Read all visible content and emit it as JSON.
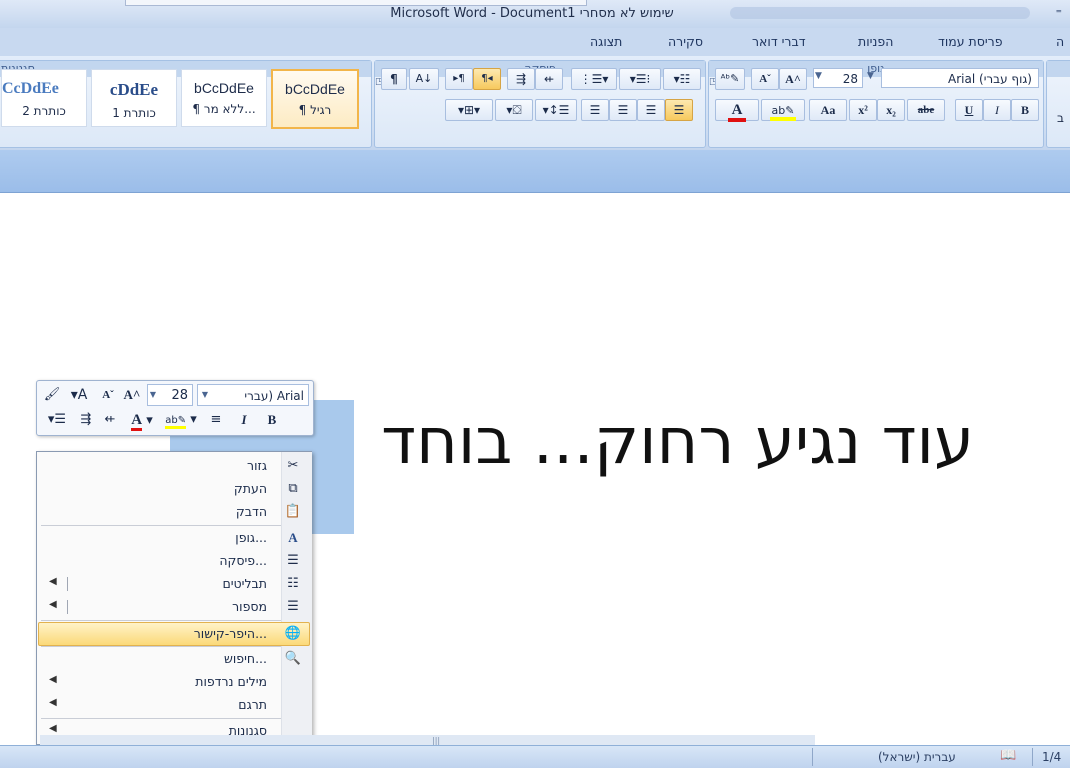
{
  "window": {
    "title_hebrew": "שימוש לא מסחרי",
    "title_app": "Microsoft Word - Document1",
    "quick_access": "⁼"
  },
  "tabs": [
    {
      "label": "ה"
    },
    {
      "label": "פריסת עמוד"
    },
    {
      "label": "הפניות"
    },
    {
      "label": "דברי דואר"
    },
    {
      "label": "סקירה"
    },
    {
      "label": "תצוגה"
    }
  ],
  "ribbon": {
    "font_group": {
      "label": "גופן",
      "font_name": "(גוף עברי) Arial",
      "font_size": "28",
      "bold": "B",
      "italic": "I",
      "underline": "U",
      "strike": "abe",
      "subscript": "x₂",
      "superscript": "x²",
      "change_case": "Aa",
      "grow": "A^",
      "shrink": "Aˇ"
    },
    "paragraph_group": {
      "label": "פיסקה"
    },
    "styles_group": {
      "label": "סגנונות",
      "tiles": [
        {
          "sample": "bCcDdEe",
          "name": "¶ רגיל"
        },
        {
          "sample": "bCcDdEe",
          "name": "¶ ללא מר..."
        },
        {
          "sample": "cDdEe",
          "name": "כותרת 1"
        },
        {
          "sample": "CcDdEe",
          "name": "כותרת 2"
        }
      ]
    },
    "edit_group": {
      "label": "ב"
    }
  },
  "document": {
    "text": "עוד נגיע רחוק... בוחד"
  },
  "mini_toolbar": {
    "font_name": "Arial (עברי",
    "font_size": "28",
    "bold": "B",
    "italic": "I",
    "align": "≡"
  },
  "context_menu": {
    "items": [
      {
        "label": "גזור",
        "icon": "scissors-icon"
      },
      {
        "label": "העתק",
        "icon": "copy-icon"
      },
      {
        "label": "הדבק",
        "icon": "paste-icon"
      },
      {
        "label": "גופן...",
        "icon": "font-icon"
      },
      {
        "label": "פיסקה...",
        "icon": "paragraph-icon"
      },
      {
        "label": "תבליטים",
        "icon": "bullets-icon",
        "submenu": true
      },
      {
        "label": "מספור",
        "icon": "numbering-icon",
        "submenu": true
      },
      {
        "label": "היפר-קישור...",
        "icon": "hyperlink-icon",
        "highlighted": true
      },
      {
        "label": "חיפוש...",
        "icon": "research-icon"
      },
      {
        "label": "מילים נרדפות",
        "icon": "",
        "submenu": true
      },
      {
        "label": "תרגם",
        "icon": "",
        "submenu": true
      },
      {
        "label": "סגנונות",
        "icon": "",
        "submenu": true
      }
    ]
  },
  "status_bar": {
    "language": "עברית (ישראל)",
    "page": "1/4"
  },
  "colors": {
    "accent": "#c8d9f0",
    "selection": "#a9c9ec",
    "menu_highlight": "#fbd979",
    "font_color_bar": "#e01010",
    "highlight_bar": "#ffff00"
  }
}
